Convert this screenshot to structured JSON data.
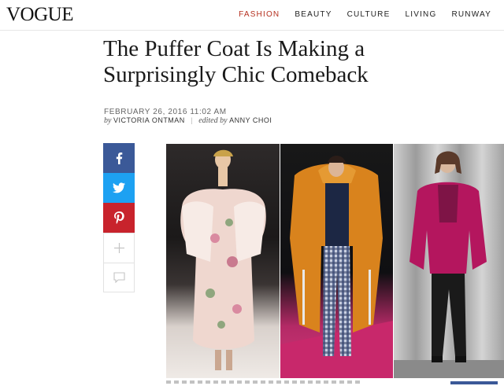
{
  "header": {
    "logo": "VOGUE",
    "nav": [
      {
        "label": "FASHION",
        "active": true
      },
      {
        "label": "BEAUTY",
        "active": false
      },
      {
        "label": "CULTURE",
        "active": false
      },
      {
        "label": "LIVING",
        "active": false
      },
      {
        "label": "RUNWAY",
        "active": false
      }
    ]
  },
  "article": {
    "title_line1": "The Puffer Coat Is Making a",
    "title_line2": "Surprisingly Chic Comeback",
    "date": "FEBRUARY 26, 2016 11:02 AM",
    "by_prefix": "by",
    "author": "VICTORIA ONTMAN",
    "editor_prefix": "edited by",
    "editor": "ANNY CHOI"
  },
  "share": {
    "icons": [
      "facebook-icon",
      "twitter-icon",
      "pinterest-icon",
      "plus-icon",
      "comment-icon"
    ]
  },
  "colors": {
    "nav_active": "#b5301f",
    "facebook": "#3b5998",
    "twitter": "#1da1f2",
    "pinterest": "#c8232c"
  }
}
